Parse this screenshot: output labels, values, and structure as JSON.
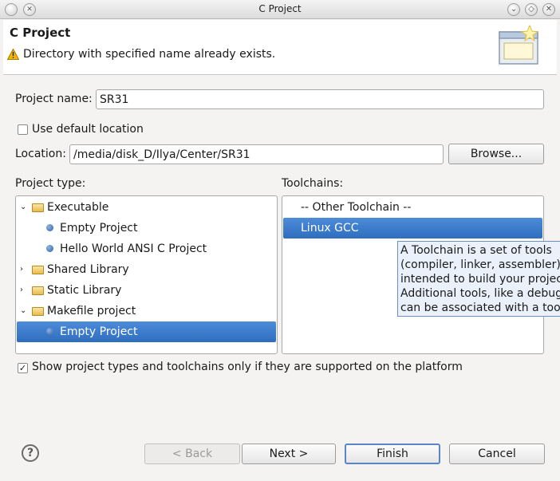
{
  "window": {
    "title": "C Project",
    "controls": {
      "minimize": "⌄",
      "maximize": "◇",
      "close": "✕"
    }
  },
  "banner": {
    "title": "C Project",
    "message": "Directory with specified name already exists."
  },
  "project_name": {
    "label": "Project name:",
    "value": "SR31"
  },
  "use_default_location": {
    "label": "Use default location",
    "checked": false
  },
  "location": {
    "label": "Location:",
    "value": "/media/disk_D/Ilya/Center/SR31",
    "browse_label": "Browse..."
  },
  "project_type": {
    "label": "Project type:",
    "items": [
      {
        "label": "Executable",
        "kind": "folder",
        "expanded": true
      },
      {
        "label": "Empty Project",
        "kind": "leaf"
      },
      {
        "label": "Hello World ANSI C Project",
        "kind": "leaf"
      },
      {
        "label": "Shared Library",
        "kind": "folder",
        "expanded": false
      },
      {
        "label": "Static Library",
        "kind": "folder",
        "expanded": false
      },
      {
        "label": "Makefile project",
        "kind": "folder",
        "expanded": true
      },
      {
        "label": "Empty Project",
        "kind": "leaf",
        "selected": true
      }
    ]
  },
  "toolchains": {
    "label": "Toolchains:",
    "items": [
      {
        "label": "-- Other Toolchain --"
      },
      {
        "label": "Linux GCC",
        "selected": true
      }
    ]
  },
  "tooltip": {
    "lines": [
      "A Toolchain is a set of tools",
      "(compiler, linker, assembler)",
      "intended to build your project.",
      "Additional tools, like a debugger,",
      "can be associated with a toolchain."
    ]
  },
  "show_supported": {
    "label": "Show project types and toolchains only if they are supported on the platform",
    "checked": true
  },
  "buttons": {
    "help": "?",
    "back": "< Back",
    "next": "Next >",
    "finish": "Finish",
    "cancel": "Cancel"
  },
  "colors": {
    "selection": "#3b7bd0",
    "tooltip_bg": "#eaf1fb",
    "warning": "#f0b400"
  },
  "icons": {
    "warning": "warning-icon",
    "wizard_banner": "new-project-wizard-icon",
    "help": "help-icon"
  }
}
